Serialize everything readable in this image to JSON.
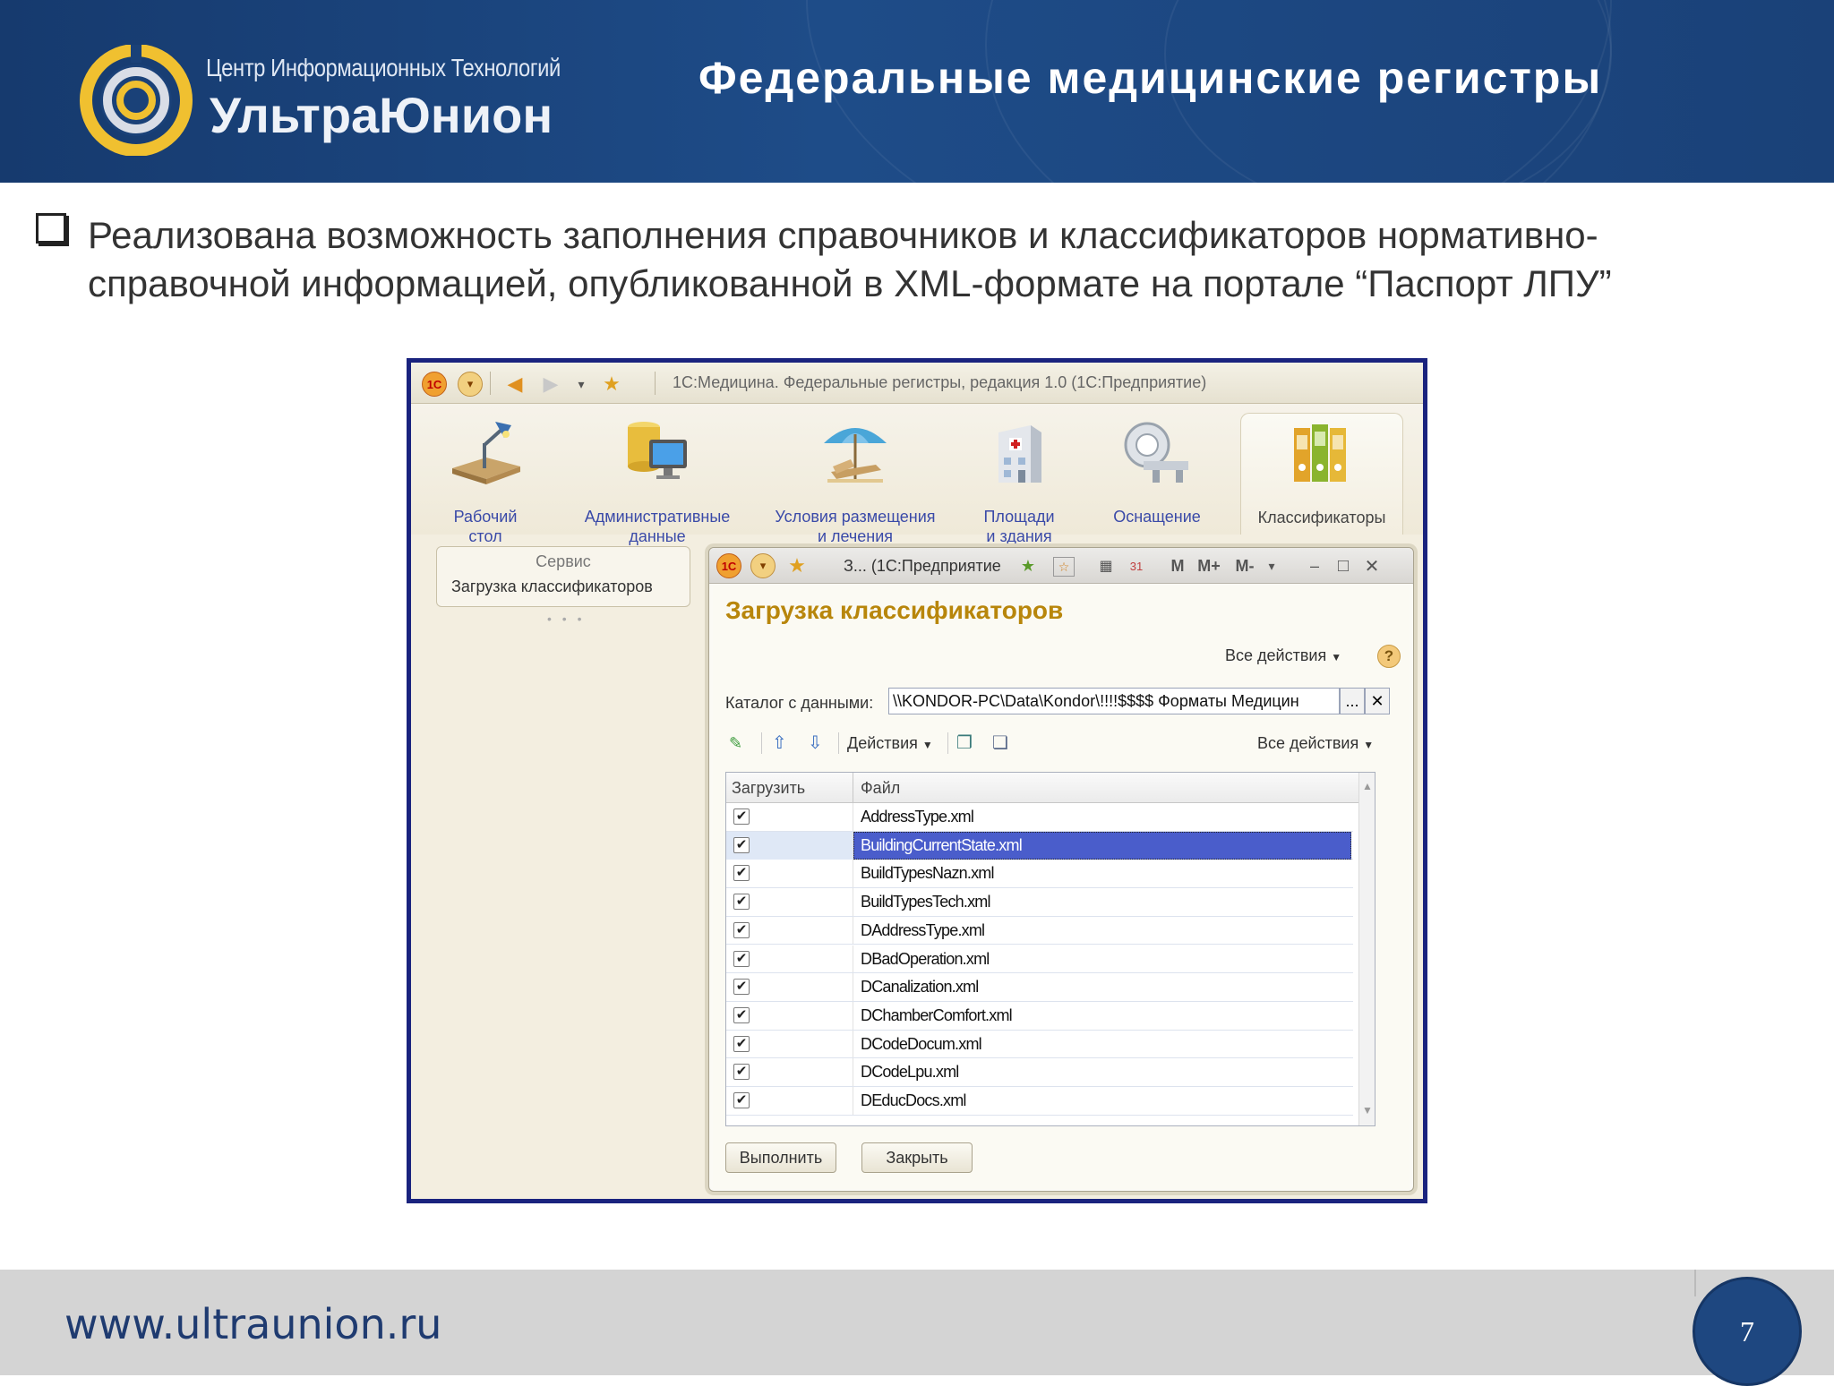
{
  "header": {
    "logo_line1": "Центр Информационных Технологий",
    "logo_line2": "УльтраЮнион",
    "title": "Федеральные медицинские регистры"
  },
  "bullet": {
    "text": "Реализована возможность заполнения справочников и классификаторов нормативно-справочной информацией, опубликованной в XML-формате на портале “Паспорт ЛПУ”"
  },
  "app": {
    "window_title": "1С:Медицина. Федеральные регистры, редакция 1.0  (1С:Предприятие)",
    "sections": [
      {
        "label": "Рабочий\nстол",
        "icon": "desk-lamp-icon"
      },
      {
        "label": "Административные\nданные",
        "icon": "database-monitor-icon"
      },
      {
        "label": "Условия размещения\nи лечения",
        "icon": "beach-umbrella-icon"
      },
      {
        "label": "Площади\nи здания",
        "icon": "hospital-building-icon"
      },
      {
        "label": "Оснащение",
        "icon": "medical-scanner-icon"
      },
      {
        "label": "Классификаторы",
        "icon": "binders-icon"
      }
    ],
    "left_panel": {
      "header": "Сервис",
      "item": "Загрузка классификаторов"
    },
    "inner_window": {
      "title": "З...  (1С:Предприятие",
      "m_label": "M",
      "mplus_label": "M+",
      "mminus_label": "M-"
    },
    "form": {
      "title": "Загрузка классификаторов",
      "all_actions": "Все действия",
      "catalog_label": "Каталог с данными:",
      "catalog_value": "\\\\KONDOR-PC\\Data\\Kondor\\!!!!$$$$ Форматы Медицин",
      "browse_label": "...",
      "clear_label": "✕",
      "actions_label": "Действия",
      "table_all_actions": "Все действия",
      "columns": [
        "Загрузить",
        "Файл"
      ],
      "rows": [
        {
          "file": "AddressType.xml",
          "checked": true
        },
        {
          "file": "BuildingCurrentState.xml",
          "checked": true,
          "selected": true
        },
        {
          "file": "BuildTypesNazn.xml",
          "checked": true
        },
        {
          "file": "BuildTypesTech.xml",
          "checked": true
        },
        {
          "file": "DAddressType.xml",
          "checked": true
        },
        {
          "file": "DBadOperation.xml",
          "checked": true
        },
        {
          "file": "DCanalization.xml",
          "checked": true
        },
        {
          "file": "DChamberComfort.xml",
          "checked": true
        },
        {
          "file": "DCodeDocum.xml",
          "checked": true
        },
        {
          "file": "DCodeLpu.xml",
          "checked": true
        },
        {
          "file": "DEducDocs.xml",
          "checked": true
        }
      ],
      "execute_button": "Выполнить",
      "close_button": "Закрыть"
    }
  },
  "footer": {
    "url": "www.ultraunion.ru",
    "page_number": "7"
  },
  "colors": {
    "header_bg": "#1a4178",
    "frame_border": "#1a237e",
    "form_title": "#b8860b",
    "selection": "#4a5dcb",
    "section_label": "#3a4aa8"
  }
}
